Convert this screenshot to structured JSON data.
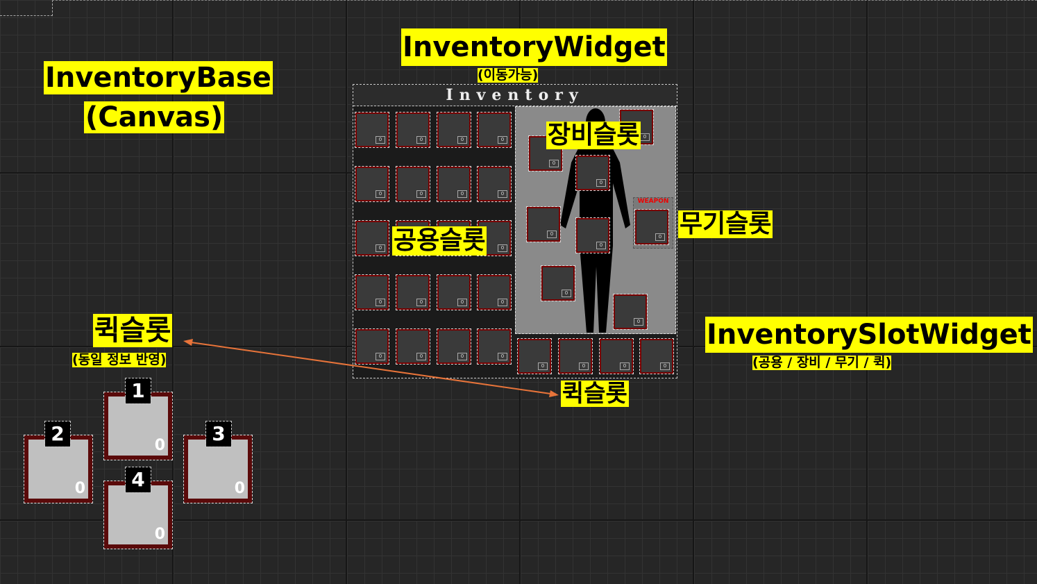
{
  "labels": {
    "inventory_base": "InventoryBase",
    "inventory_base_sub": "(Canvas)",
    "inventory_widget": "InventoryWidget",
    "inventory_widget_sub": "(이동가능)",
    "equip_slot": "장비슬롯",
    "weapon_slot": "무기슬롯",
    "common_slot": "공용슬롯",
    "quick_slot_left": "퀵슬롯",
    "quick_slot_left_sub": "(동일 정보 반영)",
    "quick_slot_panel": "퀵슬롯",
    "slot_widget": "InventorySlotWidget",
    "slot_widget_sub": "(공용 / 장비 / 무기 / 퀵)"
  },
  "panel": {
    "title": "Inventory",
    "weapon_label": "WEAPON",
    "slot_count": "0"
  },
  "quick_slots": [
    {
      "key": "1",
      "count": "0"
    },
    {
      "key": "2",
      "count": "0"
    },
    {
      "key": "3",
      "count": "0"
    },
    {
      "key": "4",
      "count": "0"
    }
  ],
  "colors": {
    "label_bg": "#ffff00",
    "slot_border": "#7a0000",
    "arrow": "#e8743a",
    "weapon_text": "#ee0000"
  }
}
